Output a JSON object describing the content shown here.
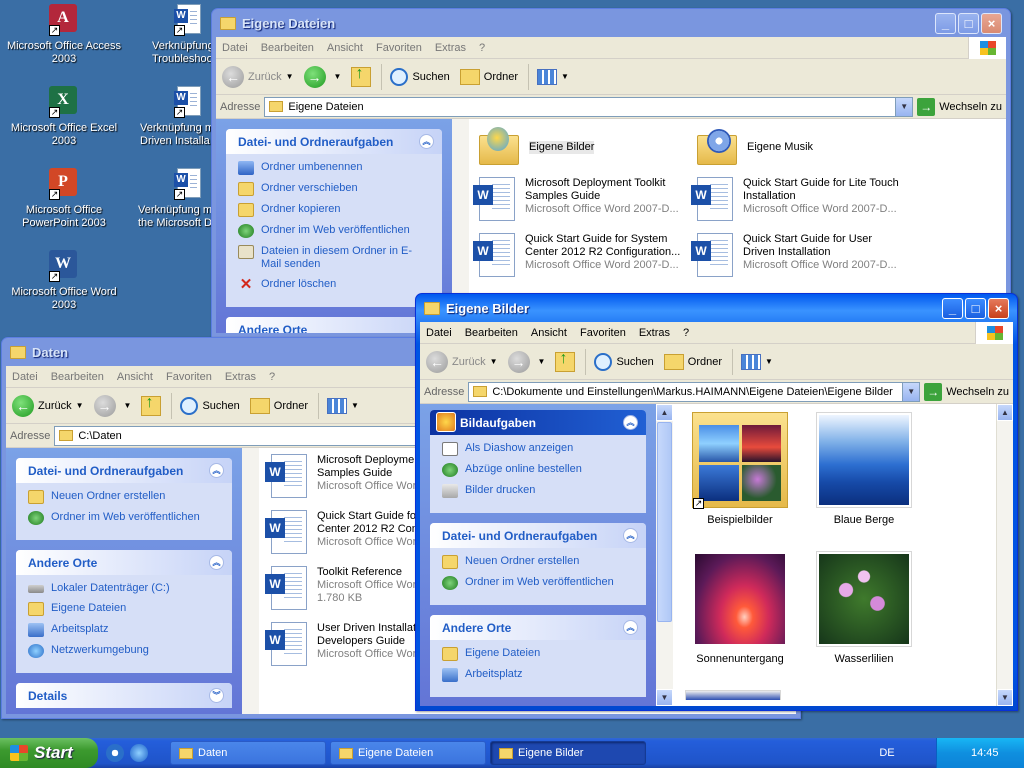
{
  "desktop": {
    "icons": [
      {
        "label": "Microsoft Office Access 2003",
        "color": "#b3273b",
        "glyph": "A"
      },
      {
        "label": "Microsoft Office Excel 2003",
        "color": "#1e7145",
        "glyph": "X"
      },
      {
        "label": "Microsoft Office PowerPoint 2003",
        "color": "#d24726",
        "glyph": "P"
      },
      {
        "label": "Microsoft Office Word 2003",
        "color": "#2b579a",
        "glyph": "W"
      }
    ],
    "shortcuts": [
      {
        "line1": "Verknüpfung",
        "line2": "Troubleshoo"
      },
      {
        "line1": "Verknüpfung m",
        "line2": "Driven Installa"
      },
      {
        "line1": "Verknüpfung m",
        "line2": "the Microsoft De"
      }
    ]
  },
  "win_eigene_dateien": {
    "title": "Eigene Dateien",
    "menu": [
      "Datei",
      "Bearbeiten",
      "Ansicht",
      "Favoriten",
      "Extras",
      "?"
    ],
    "toolbar": {
      "back": "Zurück",
      "search": "Suchen",
      "folders": "Ordner"
    },
    "address_label": "Adresse",
    "address": "Eigene Dateien",
    "go": "Wechseln zu",
    "tasks_header": "Datei- und Ordneraufgaben",
    "tasks": [
      {
        "label": "Ordner umbenennen",
        "icon": "ren"
      },
      {
        "label": "Ordner verschieben",
        "icon": "mv"
      },
      {
        "label": "Ordner kopieren",
        "icon": "cp"
      },
      {
        "label": "Ordner im Web veröffentlichen",
        "icon": "web"
      },
      {
        "label": "Dateien in diesem Ordner in E-Mail senden",
        "icon": "mail"
      },
      {
        "label": "Ordner löschen",
        "icon": "del"
      }
    ],
    "other_header": "Andere Orte",
    "folders": [
      "Eigene Bilder",
      "Eigene Musik"
    ],
    "files": [
      {
        "name": "Microsoft Deployment Toolkit Samples Guide",
        "type": "Microsoft Office Word 2007-D..."
      },
      {
        "name": "Quick Start Guide for Lite Touch Installation",
        "type": "Microsoft Office Word 2007-D..."
      },
      {
        "name": "Quick Start Guide for System Center 2012 R2 Configuration...",
        "type": "Microsoft Office Word 2007-D..."
      },
      {
        "name": "Quick Start Guide for User Driven Installation",
        "type": "Microsoft Office Word 2007-D..."
      }
    ]
  },
  "win_daten": {
    "title": "Daten",
    "menu": [
      "Datei",
      "Bearbeiten",
      "Ansicht",
      "Favoriten",
      "Extras",
      "?"
    ],
    "toolbar": {
      "back": "Zurück",
      "search": "Suchen",
      "folders": "Ordner"
    },
    "address_label": "Adresse",
    "address": "C:\\Daten",
    "tasks_header": "Datei- und Ordneraufgaben",
    "tasks": [
      {
        "label": "Neuen Ordner erstellen",
        "icon": "nf"
      },
      {
        "label": "Ordner im Web veröffentlichen",
        "icon": "web"
      }
    ],
    "other_header": "Andere Orte",
    "other": [
      {
        "label": "Lokaler Datenträger (C:)",
        "icon": "drv"
      },
      {
        "label": "Eigene Dateien",
        "icon": "nf"
      },
      {
        "label": "Arbeitsplatz",
        "icon": "pc"
      },
      {
        "label": "Netzwerkumgebung",
        "icon": "net"
      }
    ],
    "details_header": "Details",
    "files": [
      {
        "line1": "Microsoft Deploymen",
        "line2": "Samples Guide",
        "line3": "Microsoft Office Wor"
      },
      {
        "line1": "Quick Start Guide for",
        "line2": "Center 2012 R2 Conf",
        "line3": "Microsoft Office Wor"
      },
      {
        "line1": "Toolkit Reference",
        "line2": "Microsoft Office Wor",
        "line3": "1.780 KB"
      },
      {
        "line1": "User Driven Installati",
        "line2": "Developers Guide",
        "line3": "Microsoft Office Wor"
      }
    ]
  },
  "win_eigene_bilder": {
    "title": "Eigene Bilder",
    "menu": [
      "Datei",
      "Bearbeiten",
      "Ansicht",
      "Favoriten",
      "Extras",
      "?"
    ],
    "toolbar": {
      "back": "Zurück",
      "search": "Suchen",
      "folders": "Ordner"
    },
    "address_label": "Adresse",
    "address": "C:\\Dokumente und Einstellungen\\Markus.HAIMANN\\Eigene Dateien\\Eigene Bilder",
    "go": "Wechseln zu",
    "picture_tasks_header": "Bildaufgaben",
    "picture_tasks": [
      {
        "label": "Als Diashow anzeigen",
        "icon": "dia"
      },
      {
        "label": "Abzüge online bestellen",
        "icon": "web"
      },
      {
        "label": "Bilder drucken",
        "icon": "print"
      }
    ],
    "tasks_header": "Datei- und Ordneraufgaben",
    "tasks": [
      {
        "label": "Neuen Ordner erstellen",
        "icon": "nf"
      },
      {
        "label": "Ordner im Web veröffentlichen",
        "icon": "web"
      }
    ],
    "other_header": "Andere Orte",
    "other": [
      {
        "label": "Eigene Dateien",
        "icon": "nf"
      },
      {
        "label": "Arbeitsplatz",
        "icon": "pc"
      }
    ],
    "thumbnails": [
      "Beispielbilder",
      "Blaue Berge",
      "Sonnenuntergang",
      "Wasserlilien"
    ]
  },
  "taskbar": {
    "start": "Start",
    "buttons": [
      "Daten",
      "Eigene Dateien",
      "Eigene Bilder"
    ],
    "lang": "DE",
    "clock": "14:45"
  }
}
